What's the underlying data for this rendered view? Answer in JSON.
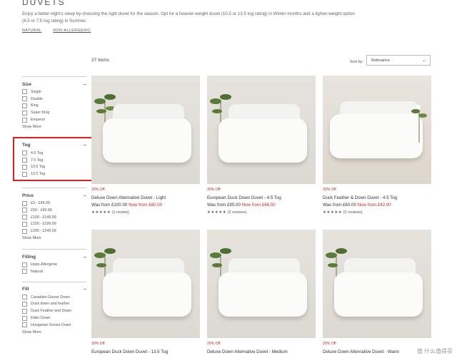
{
  "header": {
    "title": "DUVETS",
    "description": "Enjoy a better night's sleep by choosing the right duvet for the season. Opt for a heavier-weight duvet (10.5 or 13.5 tog rating) in Winter months and a lighter-weight option (4.5 or 7.5 tog rating) in Summer.",
    "tags": [
      "NATURAL",
      "NON-ALLERGENIC"
    ]
  },
  "toolbar": {
    "items_count": "27 Items",
    "sort_label": "Sort by:",
    "sort_value": "Relevance"
  },
  "filters": {
    "collapse_symbol": "−",
    "show_more": "Show More",
    "size": {
      "label": "Size",
      "options": [
        "Single",
        "Double",
        "King",
        "Super King",
        "Emperor"
      ]
    },
    "tog": {
      "label": "Tog",
      "options": [
        "4.5 Tog",
        "7.5 Tog",
        "10.5 Tog",
        "13.5 Tog"
      ]
    },
    "price": {
      "label": "Price",
      "options": [
        "£0 - £49.99",
        "£50 - £99.99",
        "£100 - £149.99",
        "£150 - £199.99",
        "£200 - £249.99"
      ]
    },
    "filling": {
      "label": "Filling",
      "options": [
        "Hypo-Allergenic",
        "Natural"
      ]
    },
    "fill": {
      "label": "Fill",
      "options": [
        "Canadian Goose Down",
        "Duck down and feather",
        "Duck Feather and Down",
        "Elder Down",
        "Hungarian Goose Down"
      ]
    }
  },
  "products": [
    {
      "sale": "20% Off",
      "name": "Deluxe Down Alternative Duvet - Light",
      "was": "Was from £100.00",
      "now": "Now from £80.00",
      "stars": "★★★★★",
      "reviews": "(1 review)"
    },
    {
      "sale": "30% Off",
      "name": "European Duck Down Duvet - 4.5 Tog",
      "was": "Was from £95.00",
      "now": "Now from £66.50",
      "stars": "★★★★★",
      "reviews": "(2 reviews)"
    },
    {
      "sale": "30% Off",
      "name": "Duck Feather & Down Duvet - 4.5 Tog",
      "was": "Was from £60.00",
      "now": "Now from £42.00",
      "stars": "★★★★★",
      "reviews": "(2 reviews)"
    },
    {
      "sale": "30% Off",
      "name": "European Duck Down Duvet - 13.5 Tog",
      "was": "",
      "now": "",
      "stars": "",
      "reviews": ""
    },
    {
      "sale": "20% Off",
      "name": "Deluxe Down Alternative Duvet - Medium",
      "was": "",
      "now": "",
      "stars": "",
      "reviews": ""
    },
    {
      "sale": "20% Off",
      "name": "Deluxe Down Alternative Duvet - Warm",
      "was": "",
      "now": "",
      "stars": "",
      "reviews": ""
    }
  ],
  "watermark": "值 什么值得买",
  "colors": {
    "accent": "#c0282d",
    "highlight_box": "#e21d24"
  }
}
